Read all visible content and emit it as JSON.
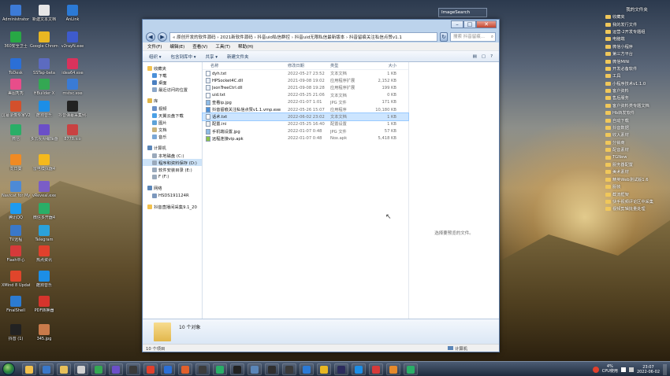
{
  "desktop": {
    "icons": [
      {
        "label": "Administrator",
        "color": "#3d7bd6"
      },
      {
        "label": "360安全卫士",
        "color": "#28a745"
      },
      {
        "label": "ToDesk",
        "color": "#2b6fd6"
      },
      {
        "label": "美图秀秀",
        "color": "#e84d8a"
      },
      {
        "label": "屏幕录像专家V2015",
        "color": "#d3502c"
      },
      {
        "label": "微信",
        "color": "#2aae67"
      },
      {
        "label": "向日葵",
        "color": "#f08a24"
      },
      {
        "label": "Navicat for MySQL",
        "color": "#4d8ad6"
      },
      {
        "label": "腾讯QQ",
        "color": "#1d9bf0"
      },
      {
        "label": "TV远程",
        "color": "#3a78c9"
      },
      {
        "label": "Flash中心",
        "color": "#d63a3a"
      },
      {
        "label": "XMind 8 Update 1",
        "color": "#e0452b"
      },
      {
        "label": "FinalShell",
        "color": "#2c7bd1"
      },
      {
        "label": "抖音 (1)",
        "color": "#222222"
      },
      {
        "label": "新建文本文档",
        "color": "#e6e6e6"
      },
      {
        "label": "Google Chrome",
        "color": "#e9b722"
      },
      {
        "label": "SSTap-beta",
        "color": "#5c6bc0"
      },
      {
        "label": "HBuilder X",
        "color": "#34a853"
      },
      {
        "label": "酷狗音乐",
        "color": "#1c8ee6"
      },
      {
        "label": "多云视频编辑器",
        "color": "#6b4fc8"
      },
      {
        "label": "雷电模拟器4",
        "color": "#f5b91c"
      },
      {
        "label": "vReveal.exe",
        "color": "#7a5dc7"
      },
      {
        "label": "微信多开器4",
        "color": "#2aae67"
      },
      {
        "label": "Telegram",
        "color": "#2aa1da"
      },
      {
        "label": "热点资讯",
        "color": "#e0402c"
      },
      {
        "label": "酷狗音乐",
        "color": "#1c8ee6"
      },
      {
        "label": "PDF转换器",
        "color": "#d6342c"
      },
      {
        "label": "345.jpg",
        "color": "#c97a4a"
      },
      {
        "label": "AnLink",
        "color": "#2b7ad6"
      },
      {
        "label": "v2rayN.exe",
        "color": "#3e5bcc"
      },
      {
        "label": "idea64.exe",
        "color": "#d9325c"
      },
      {
        "label": "mstsc.exe",
        "color": "#3a7bd5"
      },
      {
        "label": "抖音弹幕采集例子",
        "color": "#222222"
      },
      {
        "label": "8778.ico",
        "color": "#c94242"
      }
    ]
  },
  "mini_windows": [
    {
      "label": "ImageSearch"
    },
    {
      "label": "我的文件夹"
    }
  ],
  "explorer": {
    "address": "« 原创开发的软件源码 › 2021新软件源码 › 抖音uid私信群控 › 抖音uid无限私信最新版本 › 抖音留痕关注私信点赞v1.1",
    "search_placeholder": "搜索 抖音留痕...",
    "menu": [
      "文件(F)",
      "编辑(E)",
      "查看(V)",
      "工具(T)",
      "帮助(H)"
    ],
    "toolbar": [
      "组织 ▾",
      "包含到库中 ▾",
      "共享 ▾",
      "新建文件夹"
    ],
    "nav": [
      {
        "label": "收藏夹",
        "color": "#f2c14e",
        "group": "fav"
      },
      {
        "label": "下载",
        "color": "#4a90d9",
        "group": "fav"
      },
      {
        "label": "桌面",
        "color": "#4a7fc1",
        "group": "fav"
      },
      {
        "label": "最近访问的位置",
        "color": "#8aa6c8",
        "group": "fav"
      },
      {
        "label": "库",
        "color": "#e0b64a",
        "group": "lib"
      },
      {
        "label": "视频",
        "color": "#6a8fc6",
        "group": "lib"
      },
      {
        "label": "天翼云盘下载",
        "color": "#4aa0e6",
        "group": "lib"
      },
      {
        "label": "图片",
        "color": "#5fa3d8",
        "group": "lib"
      },
      {
        "label": "文档",
        "color": "#c9b37a",
        "group": "lib"
      },
      {
        "label": "音乐",
        "color": "#7aa7d6",
        "group": "lib"
      },
      {
        "label": "计算机",
        "color": "#5b86b8",
        "group": "pc"
      },
      {
        "label": "本地磁盘 (C:)",
        "color": "#9aa9bb",
        "group": "pc"
      },
      {
        "label": "程序和资料保存 (D:)",
        "color": "#9aa9bb",
        "group": "pc"
      },
      {
        "label": "软件安装目录 (E:)",
        "color": "#9aa9bb",
        "group": "pc"
      },
      {
        "label": "F (F:)",
        "color": "#9aa9bb",
        "group": "pc"
      },
      {
        "label": "网络",
        "color": "#5b86b8",
        "group": "net"
      },
      {
        "label": "HSDS191124R",
        "color": "#7c98bd",
        "group": "net"
      },
      {
        "label": "抖音直播间采集9.1_20",
        "color": "#f2c14e",
        "group": "other"
      }
    ],
    "columns": [
      "名称",
      "修改日期",
      "类型",
      "大小"
    ],
    "files": [
      {
        "name": "dyh.txt",
        "date": "2022-05-27 23:52",
        "type": "文本文档",
        "size": "1 KB"
      },
      {
        "name": "HPSocket4C.dll",
        "date": "2021-09-08 19:02",
        "type": "应用程序扩展",
        "size": "2,152 KB"
      },
      {
        "name": "JsonTreeCtrl.dll",
        "date": "2021-09-08 19:28",
        "type": "应用程序扩展",
        "size": "199 KB"
      },
      {
        "name": "uid.txt",
        "date": "2022-05-25 21:06",
        "type": "文本文档",
        "size": "0 KB"
      },
      {
        "name": "查看ip.jpg",
        "date": "2022-01-07 1:01",
        "type": "JPG 文件",
        "size": "171 KB"
      },
      {
        "name": "抖音留痕关注私信点赞v1.1.vmp.exe",
        "date": "2022-05-26 15:07",
        "type": "应用程序",
        "size": "10,180 KB"
      },
      {
        "name": "话术.txt",
        "date": "2022-06-02 23:02",
        "type": "文本文档",
        "size": "1 KB"
      },
      {
        "name": "配置.ini",
        "date": "2022-05-25 16:40",
        "type": "配置设置",
        "size": "1 KB"
      },
      {
        "name": "手机端设置.jpg",
        "date": "2022-01-07 0:48",
        "type": "JPG 文件",
        "size": "57 KB"
      },
      {
        "name": "远程连接vip.apk",
        "date": "2022-01-07 0:48",
        "type": "Nox.apk",
        "size": "5,418 KB"
      }
    ],
    "preview_msg": "选择要预览的文件。",
    "details_count": "10 个对象",
    "status_left": "10 个项目",
    "status_right": "计算机"
  },
  "right_list": {
    "header": "我的文件夹",
    "items": [
      "收藏夹",
      "我的发行文件",
      "运营-2开发专题组",
      "电脑端",
      "微信小程序",
      "第三方平台",
      "微信MiNi",
      "开发必备软件",
      "工具",
      "小程序技术v1.1.0",
      "客户资料",
      "售后服务",
      "客户资料类专题文档",
      "Hb转发软件",
      "自动下载",
      "抖音数据",
      "收入素材",
      "分销商",
      "配音素材",
      "TGNew",
      "服务器配置",
      "美术素材",
      "精英Web测试版1.6",
      "服装",
      "截流框架",
      "快手视频评论区中采集",
      "视频剪辑批量处理"
    ]
  },
  "taskbar": {
    "apps": [
      {
        "name": "explorer",
        "color": "#f2c14e"
      },
      {
        "name": "media",
        "color": "#3a78c9"
      },
      {
        "name": "folder",
        "color": "#e8c05a"
      },
      {
        "name": "notes",
        "color": "#d1d1d1"
      },
      {
        "name": "hbuilder",
        "color": "#34a853"
      },
      {
        "name": "charm",
        "color": "#6b4fc8"
      },
      {
        "name": "unknown1",
        "color": "#3a3a3a"
      },
      {
        "name": "chrome",
        "color": "#e0402c"
      },
      {
        "name": "k-app",
        "color": "#2b6fd6"
      },
      {
        "name": "design",
        "color": "#e0602c"
      },
      {
        "name": "camera",
        "color": "#3c3c3c"
      },
      {
        "name": "search",
        "color": "#2aae67"
      },
      {
        "name": "cmd",
        "color": "#222222"
      },
      {
        "name": "net",
        "color": "#5b86b8"
      },
      {
        "name": "unknown2",
        "color": "#2f2f2f"
      },
      {
        "name": "nox",
        "color": "#3a3a3a"
      },
      {
        "name": "phone",
        "color": "#2b7ad6"
      },
      {
        "name": "chrome2",
        "color": "#e9b722"
      },
      {
        "name": "idea",
        "color": "#2b2b5c"
      },
      {
        "name": "win",
        "color": "#1c8ee6"
      },
      {
        "name": "pin",
        "color": "#d63a3a"
      },
      {
        "name": "music",
        "color": "#e68a2c"
      },
      {
        "name": "wechat",
        "color": "#2aae67"
      }
    ],
    "tray_cpu": "4%\nCPU使用",
    "clock_time": "23:07",
    "clock_date": "2022-06-02"
  }
}
